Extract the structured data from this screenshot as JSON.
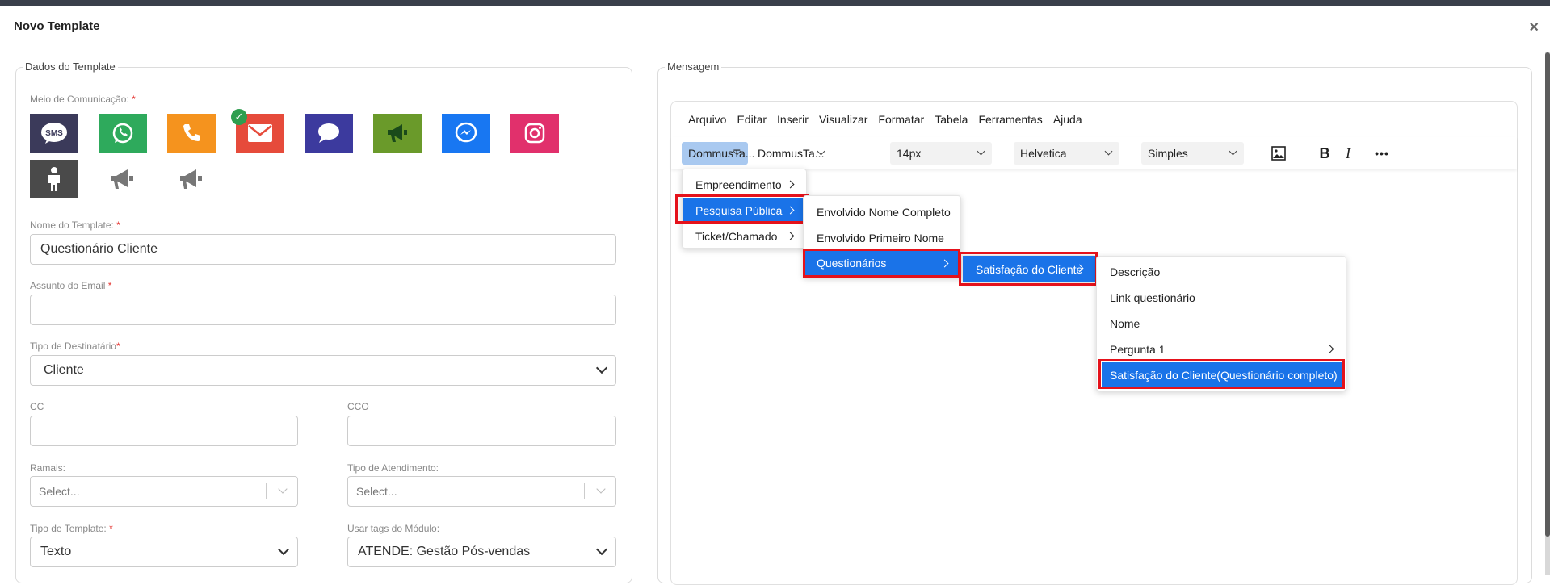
{
  "modal": {
    "title": "Novo Template",
    "close": "×"
  },
  "left": {
    "legend": "Dados do Template",
    "channel_label": "Meio de Comunicação:",
    "channels": [
      {
        "name": "sms",
        "label": "SMS",
        "color": "#3b3a5a"
      },
      {
        "name": "whatsapp",
        "color": "#2eaa5c"
      },
      {
        "name": "phone",
        "color": "#f5931e"
      },
      {
        "name": "email",
        "color": "#e64b3b",
        "selected": true
      },
      {
        "name": "chat",
        "color": "#3c3a9e"
      },
      {
        "name": "megaphone",
        "color": "#6a9a2a"
      },
      {
        "name": "messenger",
        "color": "#1877f2"
      },
      {
        "name": "instagram",
        "color": "#e1306c"
      },
      {
        "name": "person",
        "color": "#4a4a4a"
      },
      {
        "name": "megaphone-gray-1",
        "color": "#777777"
      },
      {
        "name": "megaphone-gray-2",
        "color": "#777777"
      }
    ],
    "template_name_label": "Nome do Template:",
    "template_name_value": "Questionário Cliente",
    "email_subject_label": "Assunto do Email",
    "email_subject_value": "",
    "recipient_type_label": "Tipo de Destinatário",
    "recipient_type_value": "Cliente",
    "cc_label": "CC",
    "cco_label": "CCO",
    "ramais_label": "Ramais:",
    "ramais_placeholder": "Select...",
    "attendance_label": "Tipo de Atendimento:",
    "attendance_placeholder": "Select...",
    "template_type_label": "Tipo de Template:",
    "template_type_value": "Texto",
    "module_tags_label": "Usar tags do Módulo:",
    "module_tags_value": "ATENDE: Gestão Pós-vendas",
    "required_mark": "*"
  },
  "right": {
    "legend": "Mensagem",
    "menubar": [
      "Arquivo",
      "Editar",
      "Inserir",
      "Visualizar",
      "Formatar",
      "Tabela",
      "Ferramentas",
      "Ajuda"
    ],
    "toolbar": {
      "tag1": "DommusTa...",
      "tag2": "DommusTa...",
      "font_size": "14px",
      "font_family": "Helvetica",
      "style": "Simples",
      "bold": "B",
      "italic": "I",
      "more": "•••"
    },
    "menu1": [
      "Empreendimento",
      "Pesquisa Pública",
      "Ticket/Chamado"
    ],
    "menu2": [
      "Envolvido Nome Completo",
      "Envolvido Primeiro Nome",
      "Questionários"
    ],
    "menu3": [
      "Satisfação do Cliente"
    ],
    "menu4": [
      "Descrição",
      "Link questionário",
      "Nome",
      "Pergunta 1",
      "Satisfação do Cliente(Questionário completo)"
    ]
  },
  "colors": {
    "accent": "#1a73e8",
    "highlight": "#e5121b"
  }
}
